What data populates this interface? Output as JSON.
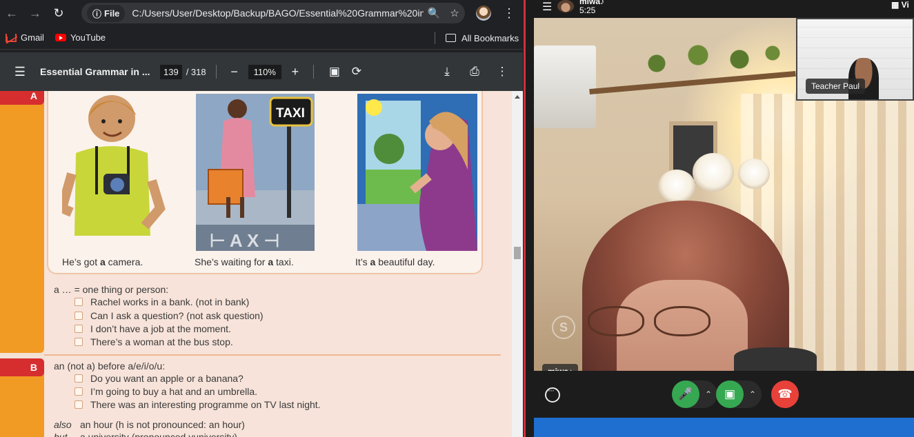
{
  "browser": {
    "url": "C:/Users/User/Desktop/Backup/BAGO/Essential%20Grammar%20in...",
    "info_label": "File",
    "bookmarks": [
      "Gmail",
      "YouTube"
    ],
    "all_bookmarks": "All Bookmarks"
  },
  "pdf": {
    "title": "Essential Grammar in ...",
    "page_current": "139",
    "page_total": "/ 318",
    "zoom": "110%",
    "section_a": "A",
    "section_b": "B",
    "captions": [
      {
        "pre": "He’s got ",
        "b": "a",
        "post": " camera."
      },
      {
        "pre": "She’s waiting for ",
        "b": "a",
        "post": " taxi."
      },
      {
        "pre": "It’s ",
        "b": "a",
        "post": " beautiful day."
      }
    ],
    "taxi_sign": "TAXI",
    "a_rule": "a … = one thing or person:",
    "a_examples": [
      "Rachel works in a bank.   (not in bank)",
      "Can I ask a question?   (not ask question)",
      "I don’t have a job at the moment.",
      "There’s a woman at the bus stop."
    ],
    "b_rule": "an (not a) before a/e/i/o/u:",
    "b_examples": [
      "Do you want an apple or a banana?",
      "I’m going to buy a hat and an umbrella.",
      "There was an interesting programme on TV last night."
    ],
    "also_label": "also",
    "also_text": "an hour (h is not pronounced: an hour)",
    "but_label": "but",
    "but_text": "a university (pronounced yuniversity)"
  },
  "call": {
    "caller_name": "miwa♪",
    "duration": "5:25",
    "view_label": "Vi",
    "self_label": "miwa♪",
    "pip_label": "Teacher Paul",
    "colors": {
      "mic_green": "#36a852",
      "hangup_red": "#e8413a"
    }
  }
}
